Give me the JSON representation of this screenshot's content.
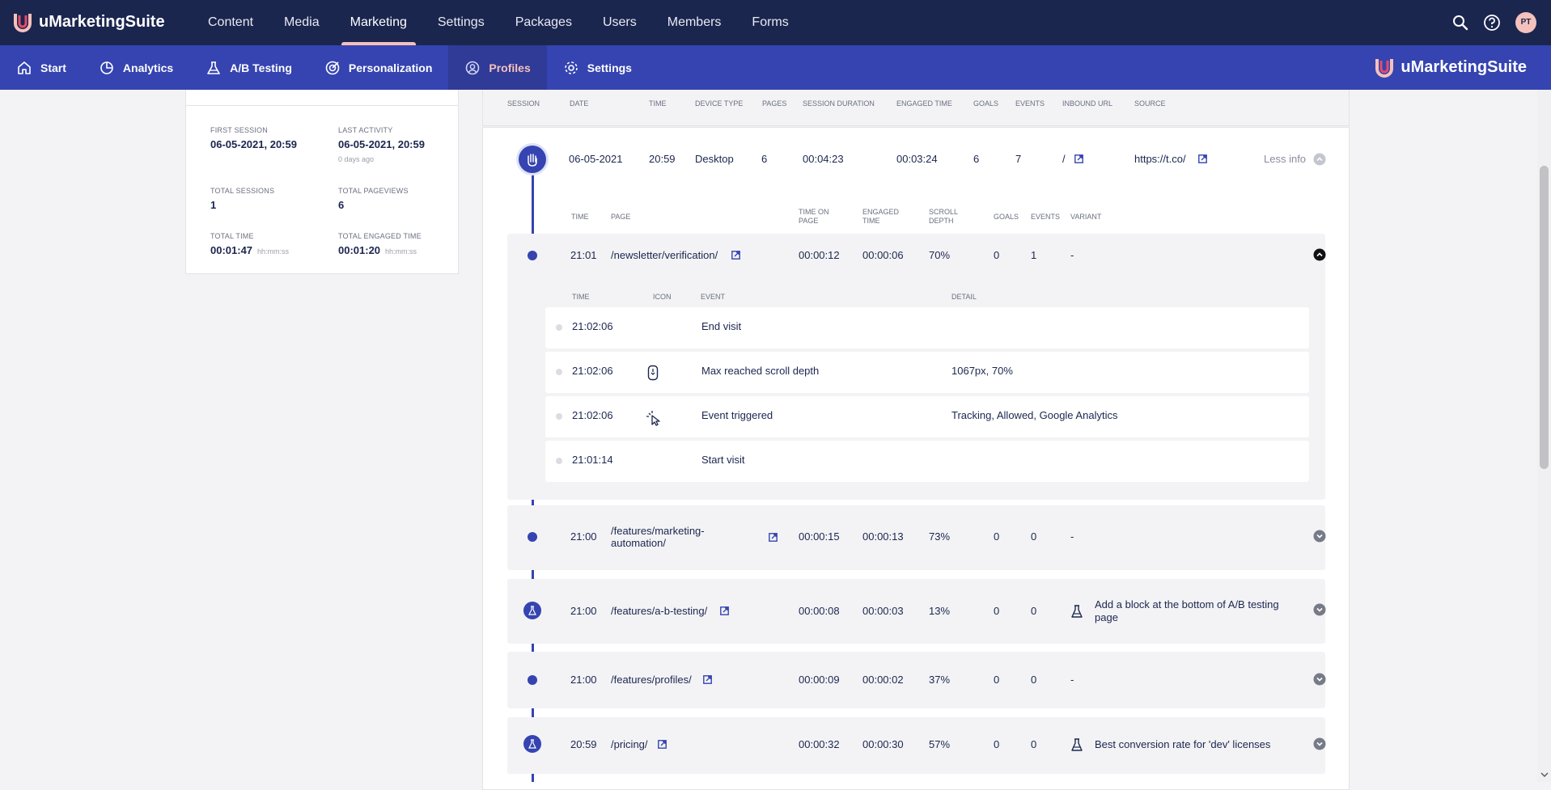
{
  "app": {
    "name": "uMarketingSuite"
  },
  "topnav": {
    "items": [
      "Content",
      "Media",
      "Marketing",
      "Settings",
      "Packages",
      "Users",
      "Members",
      "Forms"
    ],
    "active": "Marketing",
    "avatar_initials": "PT"
  },
  "subnav": {
    "items": [
      "Start",
      "Analytics",
      "A/B Testing",
      "Personalization",
      "Profiles",
      "Settings"
    ],
    "active": "Profiles",
    "brand": "uMarketingSuite"
  },
  "profile_stats": {
    "first_session": {
      "label": "FIRST SESSION",
      "value": "06-05-2021, 20:59"
    },
    "last_activity": {
      "label": "LAST ACTIVITY",
      "value": "06-05-2021, 20:59",
      "sub": "0 days ago"
    },
    "total_sessions": {
      "label": "TOTAL SESSIONS",
      "value": "1"
    },
    "total_pageviews": {
      "label": "TOTAL PAGEVIEWS",
      "value": "6"
    },
    "total_time": {
      "label": "TOTAL TIME",
      "value": "00:01:47",
      "unit": "hh:mm:ss"
    },
    "total_engaged_time": {
      "label": "TOTAL ENGAGED TIME",
      "value": "00:01:20",
      "unit": "hh:mm:ss"
    }
  },
  "session_headers": [
    "SESSION",
    "DATE",
    "TIME",
    "DEVICE TYPE",
    "PAGES",
    "SESSION DURATION",
    "ENGAGED TIME",
    "GOALS",
    "EVENTS",
    "INBOUND URL",
    "SOURCE"
  ],
  "session": {
    "date": "06-05-2021",
    "time": "20:59",
    "device": "Desktop",
    "pages": "6",
    "duration": "00:04:23",
    "engaged": "00:03:24",
    "goals": "6",
    "events": "7",
    "inbound_url": "/",
    "source": "https://t.co/",
    "toggle": "Less info"
  },
  "page_headers": {
    "time": "TIME",
    "page": "PAGE",
    "time_on_page_1": "TIME ON",
    "time_on_page_2": "PAGE",
    "engaged_1": "ENGAGED",
    "engaged_2": "TIME",
    "scroll_1": "SCROLL",
    "scroll_2": "DEPTH",
    "goals": "GOALS",
    "events": "EVENTS",
    "variant": "VARIANT"
  },
  "pageviews": [
    {
      "time": "21:01",
      "page": "/newsletter/verification/",
      "time_on_page": "00:00:12",
      "engaged": "00:00:06",
      "scroll": "70%",
      "goals": "0",
      "events": "1",
      "variant": "-"
    },
    {
      "time": "21:00",
      "page": "/features/marketing-",
      "page2": "automation/",
      "time_on_page": "00:00:15",
      "engaged": "00:00:13",
      "scroll": "73%",
      "goals": "0",
      "events": "0",
      "variant": "-"
    },
    {
      "time": "21:00",
      "page": "/features/a-b-testing/",
      "time_on_page": "00:00:08",
      "engaged": "00:00:03",
      "scroll": "13%",
      "goals": "0",
      "events": "0",
      "variant": "Add a block at the bottom of A/B testing",
      "variant2": "page"
    },
    {
      "time": "21:00",
      "page": "/features/profiles/",
      "time_on_page": "00:00:09",
      "engaged": "00:00:02",
      "scroll": "37%",
      "goals": "0",
      "events": "0",
      "variant": "-"
    },
    {
      "time": "20:59",
      "page": "/pricing/",
      "time_on_page": "00:00:32",
      "engaged": "00:00:30",
      "scroll": "57%",
      "goals": "0",
      "events": "0",
      "variant": "Best conversion rate for 'dev' licenses"
    }
  ],
  "event_headers": {
    "time": "TIME",
    "icon": "ICON",
    "event": "EVENT",
    "detail": "DETAIL"
  },
  "events": [
    {
      "time": "21:02:06",
      "event": "End visit",
      "detail": ""
    },
    {
      "time": "21:02:06",
      "event": "Max reached scroll depth",
      "detail": "1067px, 70%"
    },
    {
      "time": "21:02:06",
      "event": "Event triggered",
      "detail": "Tracking, Allowed, Google Analytics"
    },
    {
      "time": "21:01:14",
      "event": "Start visit",
      "detail": ""
    }
  ]
}
